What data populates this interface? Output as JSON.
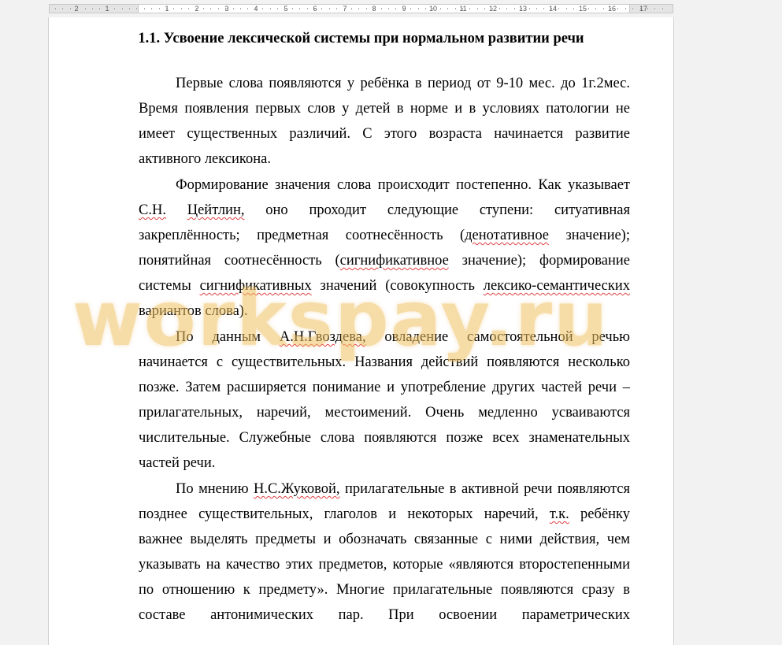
{
  "ruler": {
    "labels": [
      "2",
      "1",
      "1",
      "2",
      "3",
      "4",
      "5",
      "6",
      "7",
      "8",
      "9",
      "10",
      "11",
      "12",
      "13",
      "14",
      "15",
      "16",
      "17"
    ]
  },
  "document": {
    "heading": "1.1. Усвоение лексической системы при нормальном развитии речи",
    "lines": [
      "Первые слова появляются у ребёнка в период от 9-10 мес. до 1г.2мес.",
      "Время появления первых слов у детей в норме и в условиях патологии не",
      "имеет существенных различий. С этого возраста начинается развитие",
      "активного лексикона.",
      "Формирование значения слова происходит постепенно. Как указывает",
      "С.Н. Цейтлин, оно проходит следующие ступени: ситуативная",
      "закреплённость; предметная соотнесённость (денотативное значение);",
      "понятийная соотнесённость (сигнификативное значение); формирование",
      "системы сигнификативных значений (совокупность лексико-семантических",
      "вариантов слова).",
      "По данным А.Н.Гвоздева, овладение самостоятельной речью",
      "начинается с существительных. Названия действий появляются несколько",
      "позже. Затем расширяется понимание и употребление других частей речи –",
      "прилагательных, наречий, местоимений. Очень медленно усваиваются",
      "числительные. Служебные слова появляются позже всех знаменательных",
      "частей речи.",
      "По мнению Н.С.Жуковой, прилагательные в активной речи появляются",
      "позднее существительных, глаголов и некоторых наречий, т.к. ребёнку",
      "важнее выделять предметы и обозначать связанные с ними действия, чем",
      "указывать на качество этих предметов, которые «являются второстепенными",
      "по отношению к предмету». Многие прилагательные появляются сразу в",
      "составе антонимических пар. При освоении параметрических"
    ]
  },
  "watermark": "workspay.ru"
}
